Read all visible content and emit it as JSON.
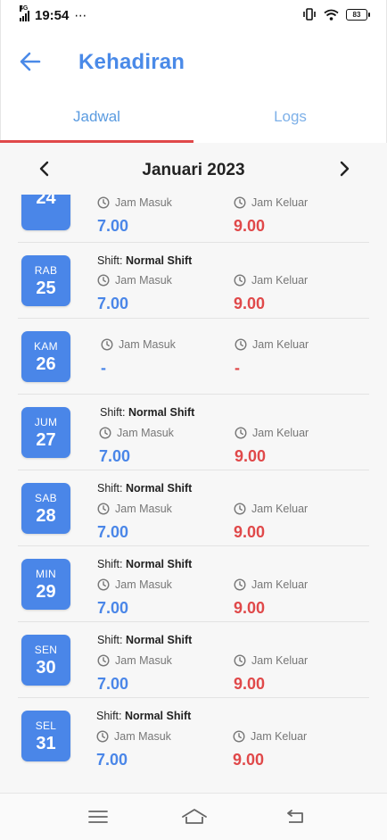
{
  "status_bar": {
    "network": "4G",
    "time": "19:54",
    "dots": "⋯",
    "battery": "83"
  },
  "header": {
    "title": "Kehadiran"
  },
  "tabs": [
    {
      "label": "Jadwal"
    },
    {
      "label": "Logs"
    }
  ],
  "month": {
    "title": "Januari 2023"
  },
  "labels": {
    "shift_prefix": "Shift: ",
    "in": "Jam Masuk",
    "out": "Jam Keluar"
  },
  "days": [
    {
      "dow": "",
      "day": "24",
      "shift": "",
      "in": "7.00",
      "out": "9.00"
    },
    {
      "dow": "RAB",
      "day": "25",
      "shift": "Normal Shift",
      "in": "7.00",
      "out": "9.00"
    },
    {
      "dow": "KAM",
      "day": "26",
      "shift": "",
      "in": "-",
      "out": "-"
    },
    {
      "dow": "JUM",
      "day": "27",
      "shift": "Normal Shift",
      "in": "7.00",
      "out": "9.00"
    },
    {
      "dow": "SAB",
      "day": "28",
      "shift": "Normal Shift",
      "in": "7.00",
      "out": "9.00"
    },
    {
      "dow": "MIN",
      "day": "29",
      "shift": "Normal Shift",
      "in": "7.00",
      "out": "9.00"
    },
    {
      "dow": "SEN",
      "day": "30",
      "shift": "Normal Shift",
      "in": "7.00",
      "out": "9.00"
    },
    {
      "dow": "SEL",
      "day": "31",
      "shift": "Normal Shift",
      "in": "7.00",
      "out": "9.00"
    }
  ],
  "colors": {
    "accent": "#4a86e8",
    "danger": "#e0494a"
  }
}
